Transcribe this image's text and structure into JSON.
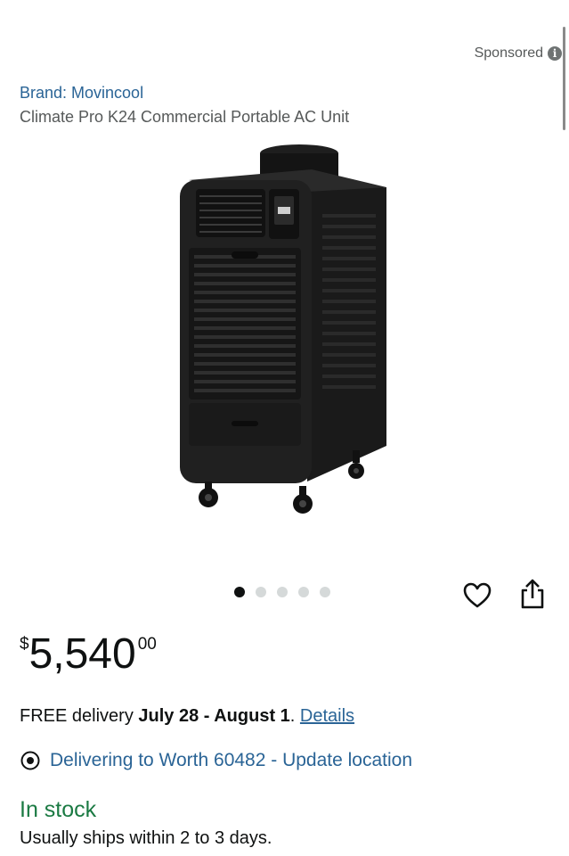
{
  "header": {
    "sponsored_label": "Sponsored",
    "info_icon": "info-icon"
  },
  "product": {
    "brand": "Brand: Movincool",
    "title": "Climate Pro K24 Commercial Portable AC Unit",
    "image_icon": "portable-ac-unit-image",
    "carousel": {
      "total": 5,
      "active_index": 0
    }
  },
  "actions": {
    "favorite_icon": "heart-icon",
    "share_icon": "share-icon"
  },
  "price": {
    "symbol": "$",
    "whole": "5,540",
    "fraction": "00"
  },
  "delivery": {
    "prefix": "FREE delivery ",
    "dates": "July 28 - August 1",
    "suffix": ". ",
    "details_link": "Details"
  },
  "location": {
    "icon": "location-pin-icon",
    "text": "Delivering to Worth 60482 - Update location"
  },
  "availability": {
    "status": "In stock",
    "ships": "Usually ships within 2 to 3 days."
  },
  "colors": {
    "link": "#2a6496",
    "in_stock": "#1b7a43",
    "text": "#0f1111",
    "muted": "#565959"
  }
}
